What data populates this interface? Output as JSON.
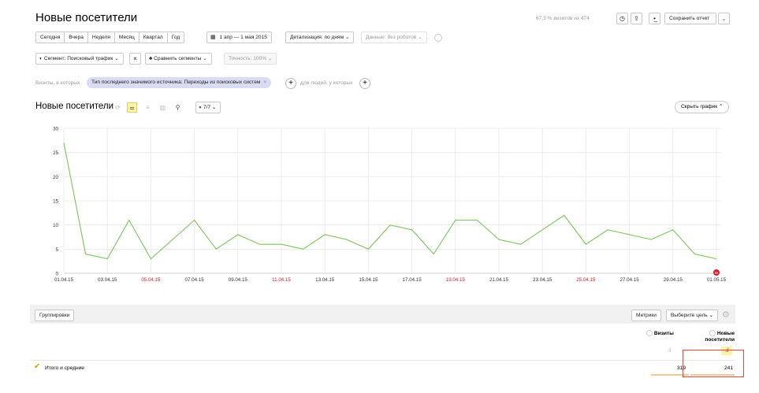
{
  "header": {
    "title": "Новые посетители",
    "visits_info": "67,3 % визитов из 474",
    "save_report": "Сохранить отчет"
  },
  "periods": [
    "Сегодня",
    "Вчера",
    "Неделя",
    "Месяц",
    "Квартал",
    "Год"
  ],
  "date_range": "1 апр — 1 мая 2015",
  "detail": "Детализация: по дням",
  "data_filter": "Данные: без роботов",
  "segment": "Сегмент: Поисковый трафик",
  "compare": "Сравнить сегменты",
  "accuracy": "Точность: 100%",
  "filter": {
    "prefix": "Визиты, в которых",
    "tag": "Тип последнего значимого источника: Переходы из поисковых систем",
    "people": "для людей, у которых"
  },
  "chart_header": {
    "title": "Новые посетители",
    "series_count": "7/7",
    "hide_chart": "Скрыть график"
  },
  "chart_data": {
    "type": "line",
    "color": "#7cc35a",
    "x": [
      "01.04.15",
      "02.04.15",
      "03.04.15",
      "04.04.15",
      "05.04.15",
      "06.04.15",
      "07.04.15",
      "08.04.15",
      "09.04.15",
      "10.04.15",
      "11.04.15",
      "12.04.15",
      "13.04.15",
      "14.04.15",
      "15.04.15",
      "16.04.15",
      "17.04.15",
      "18.04.15",
      "19.04.15",
      "20.04.15",
      "21.04.15",
      "22.04.15",
      "23.04.15",
      "24.04.15",
      "25.04.15",
      "26.04.15",
      "27.04.15",
      "28.04.15",
      "29.04.15",
      "30.04.15",
      "01.05.15"
    ],
    "values": [
      27,
      4,
      3,
      11,
      3,
      7,
      11,
      5,
      8,
      6,
      6,
      5,
      8,
      7,
      5,
      10,
      9,
      4,
      11,
      11,
      7,
      6,
      9,
      12,
      6,
      9,
      8,
      7,
      9,
      4,
      3
    ],
    "tick_labels": [
      "01.04.15",
      "03.04.15",
      "05.04.15",
      "07.04.15",
      "09.04.15",
      "11.04.15",
      "13.04.15",
      "15.04.15",
      "17.04.15",
      "19.04.15",
      "21.04.15",
      "23.04.15",
      "25.04.15",
      "27.04.15",
      "29.04.15",
      "01.05.15"
    ],
    "weekend_ticks": [
      "05.04.15",
      "11.04.15",
      "19.04.15",
      "25.04.15"
    ],
    "weekend_color": "#d4222a",
    "y_ticks": [
      0,
      5,
      10,
      15,
      20,
      25,
      30
    ],
    "ylim": [
      0,
      30
    ],
    "grid": true,
    "marker_label": "М"
  },
  "table": {
    "groupings": "Группировки",
    "metrics": "Метрики",
    "choose_goal": "Выберите цель",
    "col_visits": "Визиты",
    "col_new_visitors_1": "Новые",
    "col_new_visitors_2": "посетители",
    "total_label": "Итого и средние",
    "total_visits": "319",
    "total_new": "241"
  }
}
